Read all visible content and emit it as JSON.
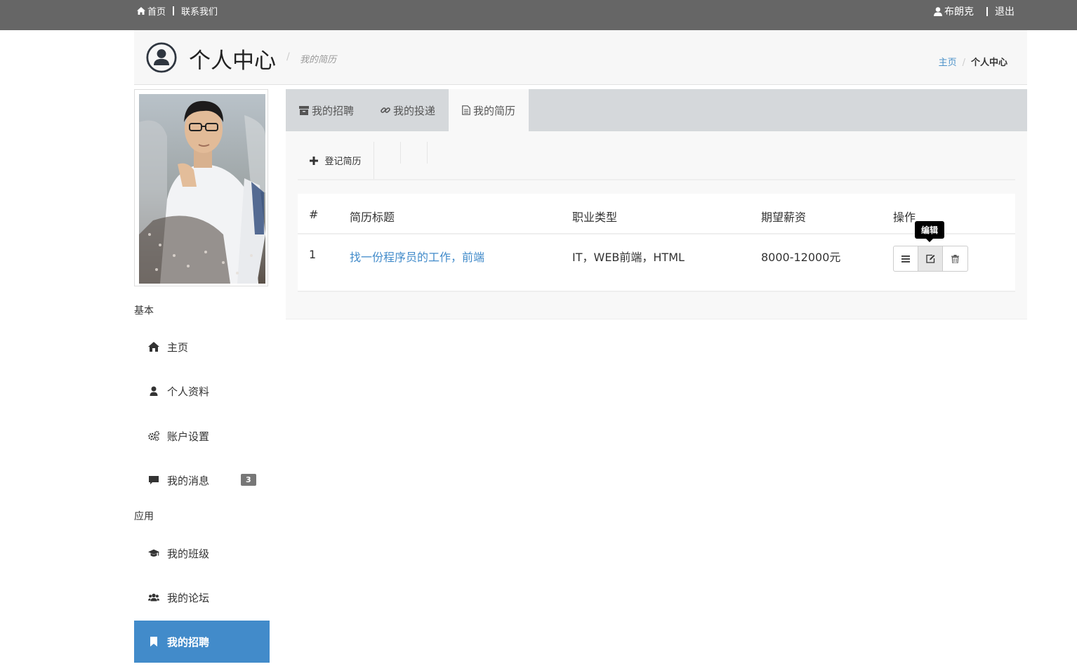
{
  "topbar": {
    "home": "首页",
    "contact": "联系我们",
    "user": "布朗克",
    "logout": "退出"
  },
  "header": {
    "title": "个人中心",
    "subtitle": "我的简历",
    "breadcrumb_home": "主页",
    "breadcrumb_current": "个人中心"
  },
  "sidebar": {
    "section_basic": "基本",
    "section_apps": "应用",
    "items": [
      {
        "label": "主页",
        "icon": "home-icon"
      },
      {
        "label": "个人资料",
        "icon": "user-icon"
      },
      {
        "label": "账户设置",
        "icon": "gears-icon"
      },
      {
        "label": "我的消息",
        "icon": "comment-icon",
        "badge": "3"
      },
      {
        "label": "我的班级",
        "icon": "graduation-cap-icon"
      },
      {
        "label": "我的论坛",
        "icon": "users-icon"
      },
      {
        "label": "我的招聘",
        "icon": "bookmark-icon",
        "active": true
      }
    ]
  },
  "tabs": [
    {
      "label": "我的招聘",
      "icon": "archive-icon"
    },
    {
      "label": "我的投递",
      "icon": "link-icon"
    },
    {
      "label": "我的简历",
      "icon": "file-icon",
      "active": true
    }
  ],
  "toolbar": {
    "add_label": "登记简历"
  },
  "table": {
    "headers": [
      "#",
      "简历标题",
      "职业类型",
      "期望薪资",
      "操作"
    ],
    "rows": [
      {
        "num": "1",
        "title": "找一份程序员的工作，前端",
        "type": "IT，WEB前端，HTML",
        "salary": "8000-12000元"
      }
    ],
    "tooltip": "编辑"
  },
  "colors": {
    "topbar": "#666666",
    "accent": "#428bca",
    "tabs_bg": "#d5d8db"
  }
}
